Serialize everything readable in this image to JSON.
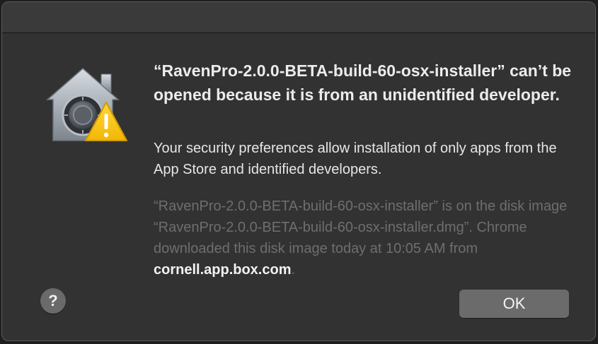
{
  "dialog": {
    "icon": "gatekeeper-lock-warning-icon",
    "headline": "“RavenPro-2.0.0-BETA-build-60-osx-installer” can’t be opened because it is from an unidentified developer.",
    "info": "Your security preferences allow installation of only apps from the App Store and identified developers.",
    "details_text": "“RavenPro-2.0.0-BETA-build-60-osx-installer” is on the disk image “RavenPro-2.0.0-BETA-build-60-osx-installer.dmg”. Chrome downloaded this disk image today at 10:05 AM from ",
    "details_domain": "cornell.app.box.com",
    "details_end": ".",
    "help_label": "?",
    "ok_label": "OK"
  },
  "colors": {
    "dialog_background": "#323232",
    "titlebar_background": "#3a3a3a",
    "button_background": "#6b6b6b",
    "warning_yellow": "#f7c619"
  }
}
